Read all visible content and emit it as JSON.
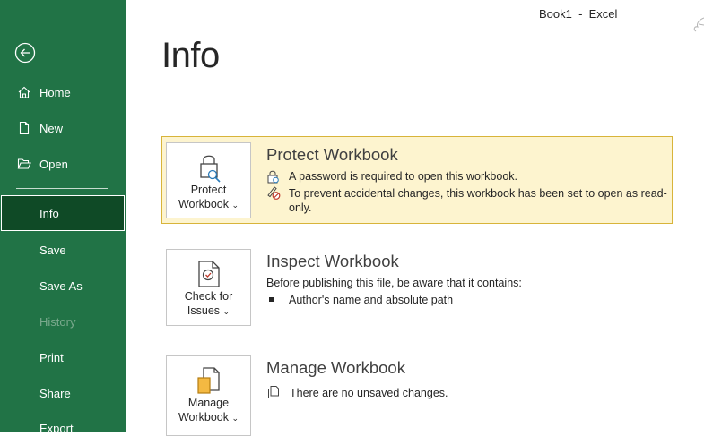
{
  "window": {
    "title": "Book1  -  Excel"
  },
  "sidebar": {
    "back_icon": "back-arrow-icon",
    "items": [
      {
        "label": "Home",
        "icon": "home-icon"
      },
      {
        "label": "New",
        "icon": "new-document-icon"
      },
      {
        "label": "Open",
        "icon": "folder-open-icon"
      },
      {
        "label": "Info",
        "active": true
      },
      {
        "label": "Save"
      },
      {
        "label": "Save As"
      },
      {
        "label": "History",
        "disabled": true
      },
      {
        "label": "Print"
      },
      {
        "label": "Share"
      },
      {
        "label": "Export"
      }
    ]
  },
  "main": {
    "page_title": "Info",
    "protect": {
      "tile_label_1": "Protect",
      "tile_label_2": "Workbook",
      "title": "Protect Workbook",
      "line1": "A password is required to open this workbook.",
      "line2a": "To prevent accidental changes, this workbook has been set to open as read-",
      "line2b": "only."
    },
    "inspect": {
      "tile_label_1": "Check for",
      "tile_label_2": "Issues",
      "title": "Inspect Workbook",
      "line1": "Before publishing this file, be aware that it contains:",
      "bullet1": "Author's name and absolute path"
    },
    "manage": {
      "tile_label_1": "Manage",
      "tile_label_2": "Workbook",
      "title": "Manage Workbook",
      "line1": "There are no unsaved changes."
    }
  },
  "colors": {
    "sidebar": "#217346",
    "active_item": "#0f4a26",
    "warning_bg": "#fdf4cf",
    "warning_border": "#d8b43a"
  }
}
